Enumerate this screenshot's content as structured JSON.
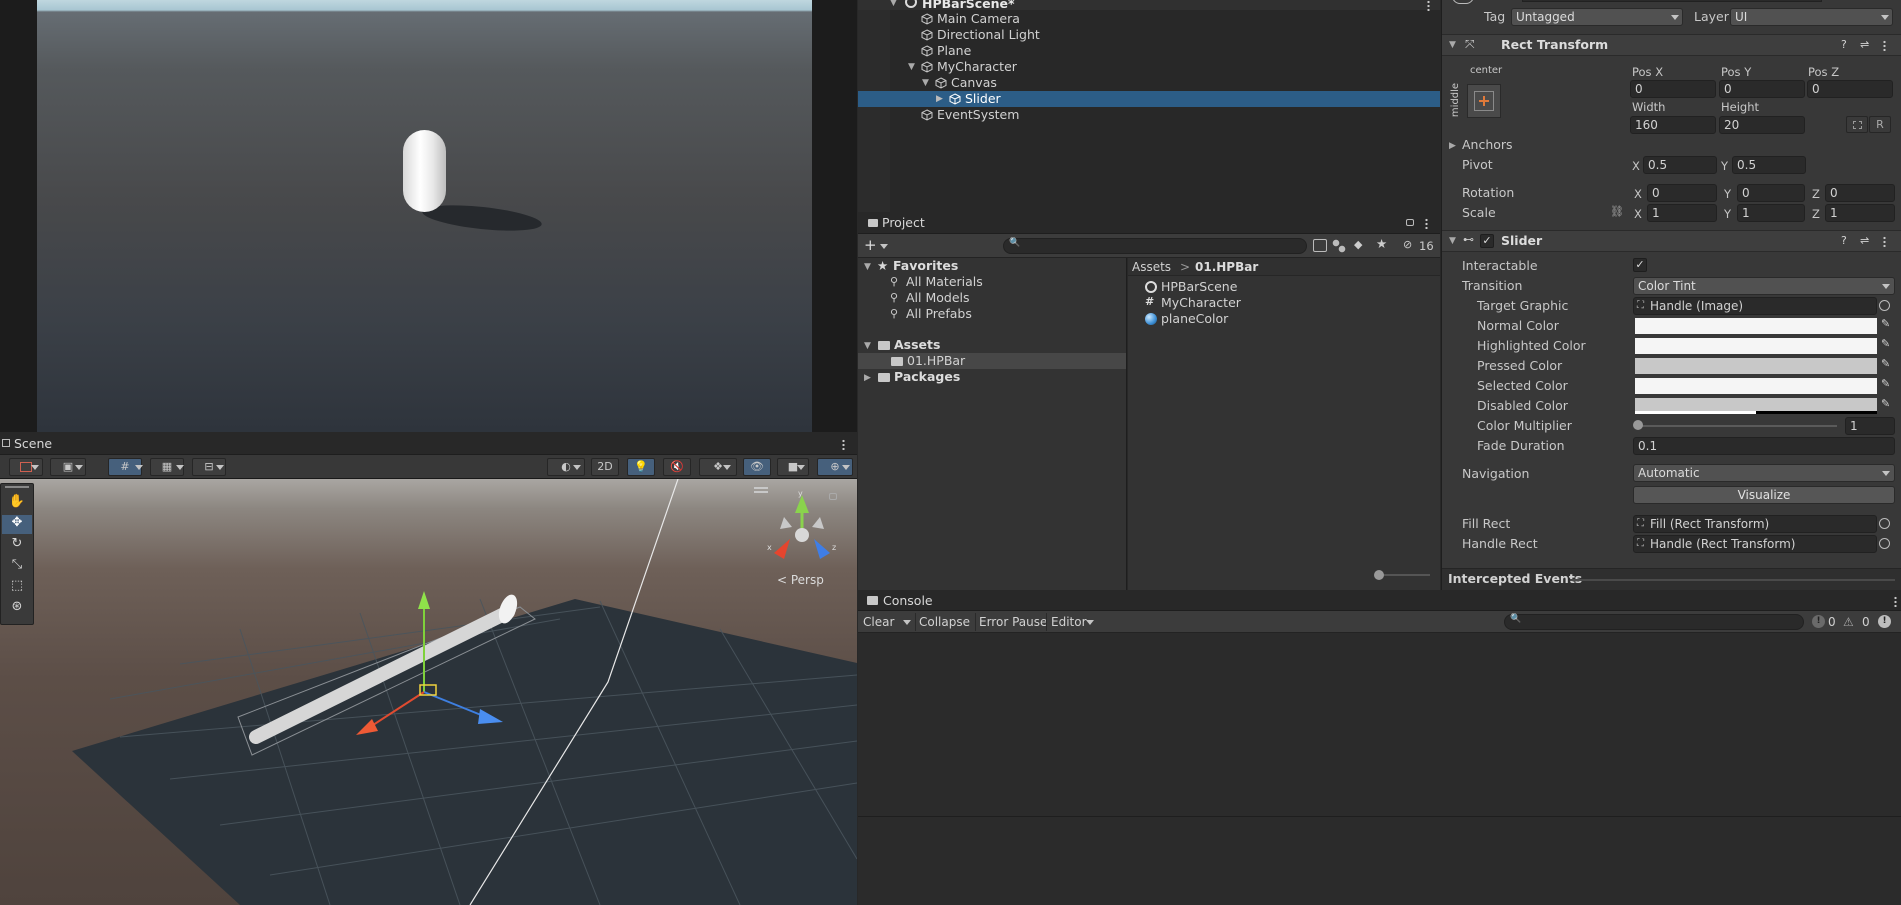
{
  "hierarchy": {
    "scene_name": "HPBarScene*",
    "items": [
      {
        "label": "Main Camera"
      },
      {
        "label": "Directional Light"
      },
      {
        "label": "Plane"
      },
      {
        "label": "MyCharacter"
      },
      {
        "label": "Canvas"
      },
      {
        "label": "Slider"
      },
      {
        "label": "EventSystem"
      }
    ]
  },
  "scene": {
    "tab_label": "Scene",
    "toolbar": {
      "mode_2d": "2D"
    },
    "persp_label": "< Persp",
    "gizmo": {
      "x": "x",
      "y": "y",
      "z": "z"
    }
  },
  "project": {
    "tab_label": "Project",
    "hidden_count": "16",
    "favorites": {
      "label": "Favorites",
      "items": [
        "All Materials",
        "All Models",
        "All Prefabs"
      ]
    },
    "assets": {
      "label": "Assets",
      "folder": "01.HPBar"
    },
    "packages": "Packages",
    "breadcrumb": {
      "root": "Assets",
      "sep": ">",
      "current": "01.HPBar"
    },
    "files": [
      {
        "label": "HPBarScene"
      },
      {
        "label": "MyCharacter"
      },
      {
        "label": "planeColor"
      }
    ]
  },
  "inspector": {
    "tag_label": "Tag",
    "tag_value": "Untagged",
    "layer_label": "Layer",
    "layer_value": "UI",
    "rect_transform": {
      "title": "Rect Transform",
      "anchor_top": "center",
      "anchor_side": "middle",
      "posx_label": "Pos X",
      "posx": "0",
      "posy_label": "Pos Y",
      "posy": "0",
      "posz_label": "Pos Z",
      "posz": "0",
      "width_label": "Width",
      "width": "160",
      "height_label": "Height",
      "height": "20",
      "r_button": "R",
      "anchors": "Anchors",
      "pivot": "Pivot",
      "pivot_x": "0.5",
      "pivot_y": "0.5",
      "rotation": "Rotation",
      "rot_x": "0",
      "rot_y": "0",
      "rot_z": "0",
      "scale": "Scale",
      "scale_x": "1",
      "scale_y": "1",
      "scale_z": "1",
      "x": "X",
      "y": "Y",
      "z": "Z"
    },
    "slider": {
      "title": "Slider",
      "interactable": "Interactable",
      "transition": "Transition",
      "transition_value": "Color Tint",
      "target_graphic": "Target Graphic",
      "target_graphic_value": "Handle (Image)",
      "normal_color": "Normal Color",
      "highlighted_color": "Highlighted Color",
      "pressed_color": "Pressed Color",
      "selected_color": "Selected Color",
      "disabled_color": "Disabled Color",
      "color_multiplier": "Color Multiplier",
      "color_multiplier_value": "1",
      "fade_duration": "Fade Duration",
      "fade_duration_value": "0.1",
      "navigation": "Navigation",
      "navigation_value": "Automatic",
      "visualize": "Visualize",
      "fill_rect": "Fill Rect",
      "fill_rect_value": "Fill (Rect Transform)",
      "handle_rect": "Handle Rect",
      "handle_rect_value": "Handle (Rect Transform)"
    },
    "intercepted_events": "Intercepted Events",
    "colors": {
      "normal": "#f5f5f5",
      "highlighted": "#f5f5f5",
      "pressed": "#c8c8c8",
      "selected": "#f5f5f5",
      "disabled": "#c8c8c8"
    }
  },
  "console": {
    "tab_label": "Console",
    "clear": "Clear",
    "collapse": "Collapse",
    "error_pause": "Error Pause",
    "editor": "Editor",
    "log_count": "0",
    "warn_count": "0"
  }
}
